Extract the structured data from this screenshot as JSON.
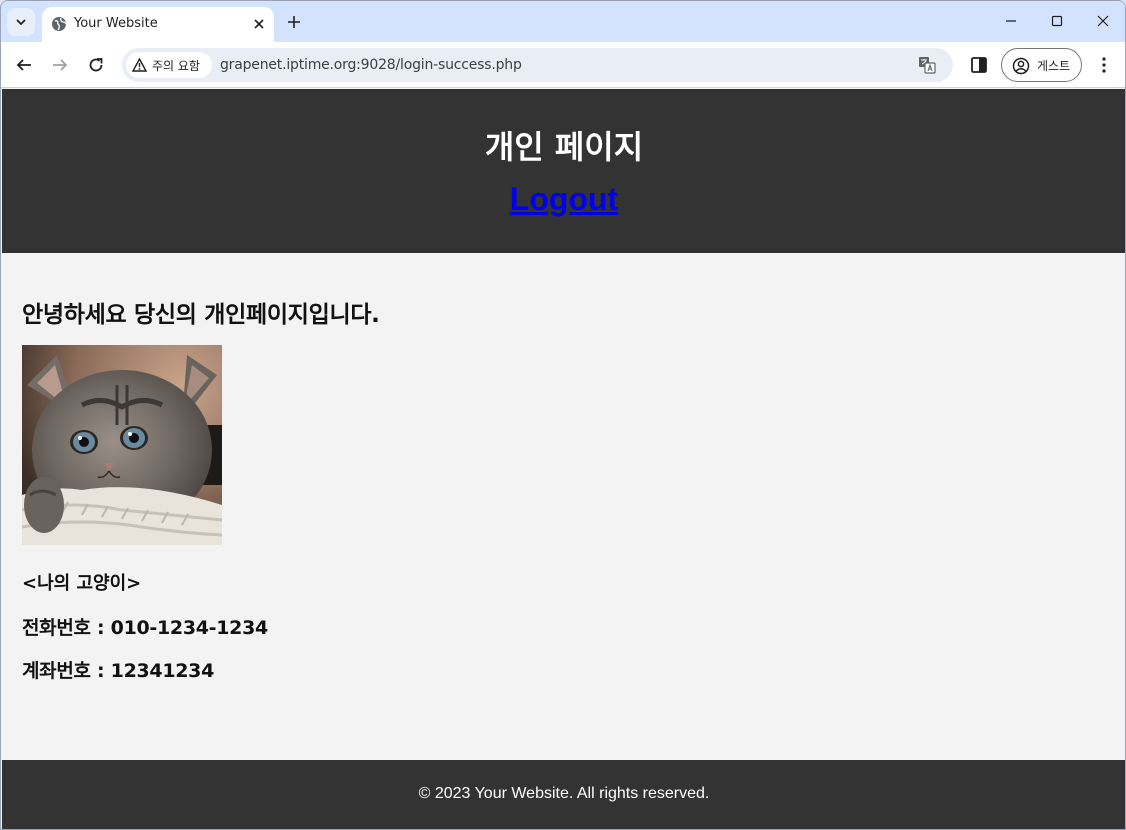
{
  "browser": {
    "tab_title": "Your Website",
    "security_label": "주의 요함",
    "url": "grapenet.iptime.org:9028/login-success.php",
    "profile_label": "게스트"
  },
  "header": {
    "title": "개인 페이지",
    "logout_label": "Logout"
  },
  "main": {
    "greeting": "안녕하세요 당신의 개인페이지입니다.",
    "photo_caption": "<나의 고양이>",
    "phone_line": "전화번호 : 010-1234-1234",
    "account_line": "계좌번호 : 12341234"
  },
  "footer": {
    "text": "© 2023 Your Website. All rights reserved."
  },
  "colors": {
    "header_bg": "#333333",
    "page_bg": "#f3f3f3",
    "link": "#0000ee",
    "tabstrip": "#d3e3fd"
  }
}
